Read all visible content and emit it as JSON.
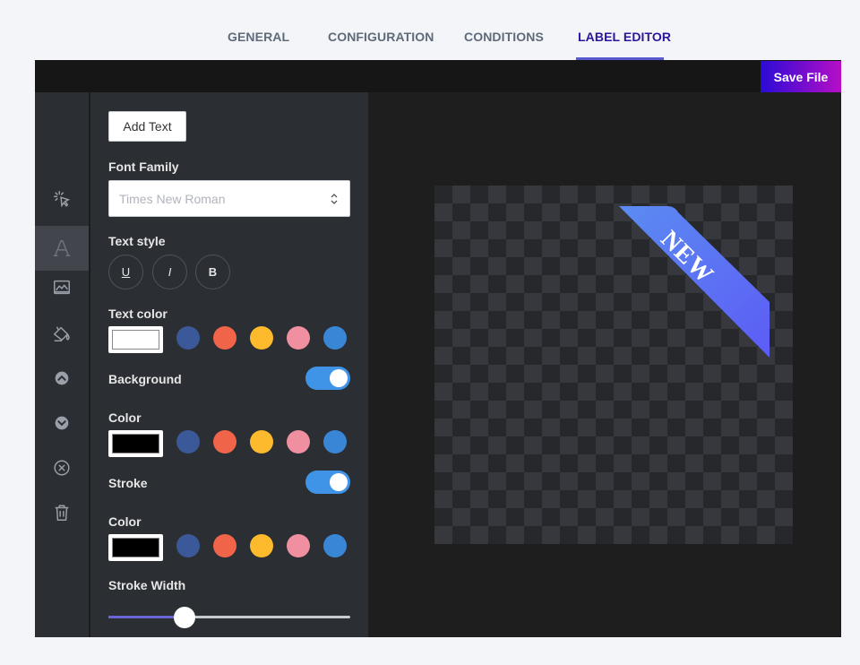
{
  "tabs": [
    {
      "label": "GENERAL"
    },
    {
      "label": "CONFIGURATION"
    },
    {
      "label": "CONDITIONS"
    },
    {
      "label": "LABEL EDITOR"
    }
  ],
  "toolbar": {
    "save_label": "Save File"
  },
  "rail": {
    "icons": [
      "select-pointer-icon",
      "text-icon",
      "image-chart-icon",
      "paint-bucket-icon",
      "chevron-up-circle-icon",
      "chevron-down-circle-icon",
      "close-circle-icon",
      "trash-icon"
    ],
    "active_index": 1
  },
  "panel": {
    "add_text_label": "Add Text",
    "font_family_label": "Font Family",
    "font_family_placeholder": "Times New Roman",
    "text_style_label": "Text style",
    "style_buttons": [
      "U",
      "I",
      "B"
    ],
    "text_color_label": "Text color",
    "background_label": "Background",
    "background_enabled": true,
    "bg_color_label": "Color",
    "stroke_label": "Stroke",
    "stroke_enabled": true,
    "stroke_color_label": "Color",
    "stroke_width_label": "Stroke Width",
    "stroke_width_fraction": 0.31,
    "text_color_selected": "#ffffff",
    "bg_color_selected": "#000000",
    "stroke_color_selected": "#000000",
    "palette": [
      "#3b5998",
      "#f06449",
      "#fdba2c",
      "#ef8fa0",
      "#3a86d6"
    ]
  },
  "canvas": {
    "ribbon_text": "NEW",
    "ribbon_gradient": [
      "#5b8cf2",
      "#5c5cf5"
    ]
  }
}
